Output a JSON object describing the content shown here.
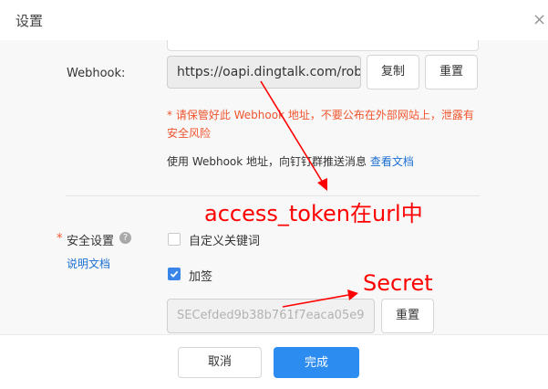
{
  "dialog": {
    "title": "设置",
    "close_symbol": "×"
  },
  "webhook": {
    "label": "Webhook:",
    "value": "https://oapi.dingtalk.com/robot/send?access_token=",
    "copy_label": "复制",
    "reset_label": "重置",
    "warning": "* 请保管好此 Webhook 地址，不要公布在外部网站上，泄露有安全风险",
    "hint": "使用 Webhook 地址，向钉钉群推送消息",
    "hint_link": "查看文档"
  },
  "security": {
    "required_mark": "*",
    "label": "安全设置",
    "help_symbol": "?",
    "doc_link": "说明文档",
    "custom_keyword": {
      "label": "自定义关键词",
      "checked": false
    },
    "sign": {
      "label": "加签",
      "checked": true
    },
    "secret_value": "SECefded9b38b761f7eaca05e9",
    "reset_label": "重置"
  },
  "footer": {
    "cancel_label": "取消",
    "done_label": "完成"
  },
  "annotations": {
    "access_token": "access_token在url中",
    "secret": "Secret",
    "color": "#ff0000"
  },
  "colors": {
    "primary": "#2d8cf0",
    "warning": "#f0552e",
    "link": "#1b6fd1"
  }
}
